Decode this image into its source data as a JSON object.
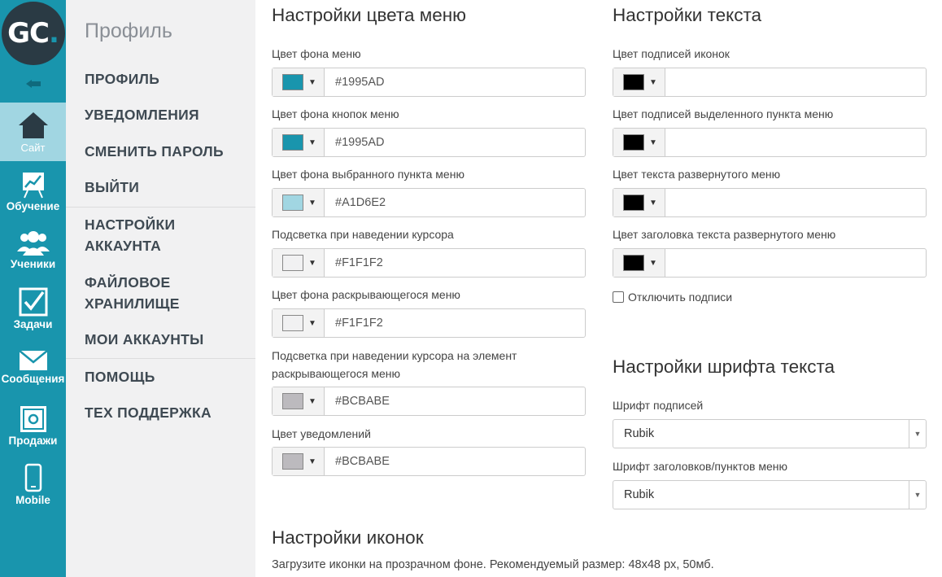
{
  "logo": {
    "text": "GC",
    "dot": "."
  },
  "sidebar": {
    "items": [
      {
        "icon": "house-icon",
        "label": "Сайт",
        "active": true
      },
      {
        "icon": "chart-board-icon",
        "label": "Обучение"
      },
      {
        "icon": "users-icon",
        "label": "Ученики"
      },
      {
        "icon": "checkbox-icon",
        "label": "Задачи"
      },
      {
        "icon": "envelope-icon",
        "label": "Сообщения"
      },
      {
        "icon": "safe-icon",
        "label": "Продажи"
      },
      {
        "icon": "phone-icon",
        "label": "Mobile"
      }
    ]
  },
  "menu": {
    "title": "Профиль",
    "items": [
      "ПРОФИЛЬ",
      "УВЕДОМЛЕНИЯ",
      "СМЕНИТЬ ПАРОЛЬ",
      "ВЫЙТИ",
      "НАСТРОЙКИ АККАУНТА",
      "ФАЙЛОВОЕ ХРАНИЛИЩЕ",
      "МОИ АККАУНТЫ",
      "ПОМОЩЬ",
      "ТЕХ ПОДДЕРЖКА"
    ]
  },
  "menu_colors": {
    "title": "Настройки цвета меню",
    "fields": [
      {
        "label": "Цвет фона меню",
        "value": "#1995AD",
        "color": "#1995AD"
      },
      {
        "label": "Цвет фона кнопок меню",
        "value": "#1995AD",
        "color": "#1995AD"
      },
      {
        "label": "Цвет фона выбранного пункта меню",
        "value": "#A1D6E2",
        "color": "#A1D6E2"
      },
      {
        "label": "Подсветка при наведении курсора",
        "value": "#F1F1F2",
        "color": "#F1F1F2"
      },
      {
        "label": "Цвет фона раскрывающегося меню",
        "value": "#F1F1F2",
        "color": "#F1F1F2"
      },
      {
        "label_line1": "Подсветка при наведении курсора на элемент",
        "label_line2": "раскрывающегося меню",
        "value": "#BCBABE",
        "color": "#BCBABE"
      },
      {
        "label": "Цвет уведомлений",
        "value": "#BCBABE",
        "color": "#BCBABE"
      }
    ]
  },
  "text_settings": {
    "title": "Настройки текста",
    "fields": [
      {
        "label": "Цвет подписей иконок",
        "value": "",
        "color": "#000000"
      },
      {
        "label": "Цвет подписей выделенного пункта меню",
        "value": "",
        "color": "#000000"
      },
      {
        "label": "Цвет текста развернутого меню",
        "value": "",
        "color": "#000000"
      },
      {
        "label": "Цвет заголовка текста развернутого меню",
        "value": "",
        "color": "#000000"
      }
    ],
    "checkbox_label": "Отключить подписи"
  },
  "font_settings": {
    "title": "Настройки шрифта текста",
    "fields": [
      {
        "label": "Шрифт подписей",
        "value": "Rubik"
      },
      {
        "label": "Шрифт заголовков/пунктов меню",
        "value": "Rubik"
      }
    ]
  },
  "icon_settings": {
    "title": "Настройки иконок",
    "note": "Загрузите иконки на прозрачном фоне. Рекомендуемый размер: 48x48 px, 50мб."
  }
}
